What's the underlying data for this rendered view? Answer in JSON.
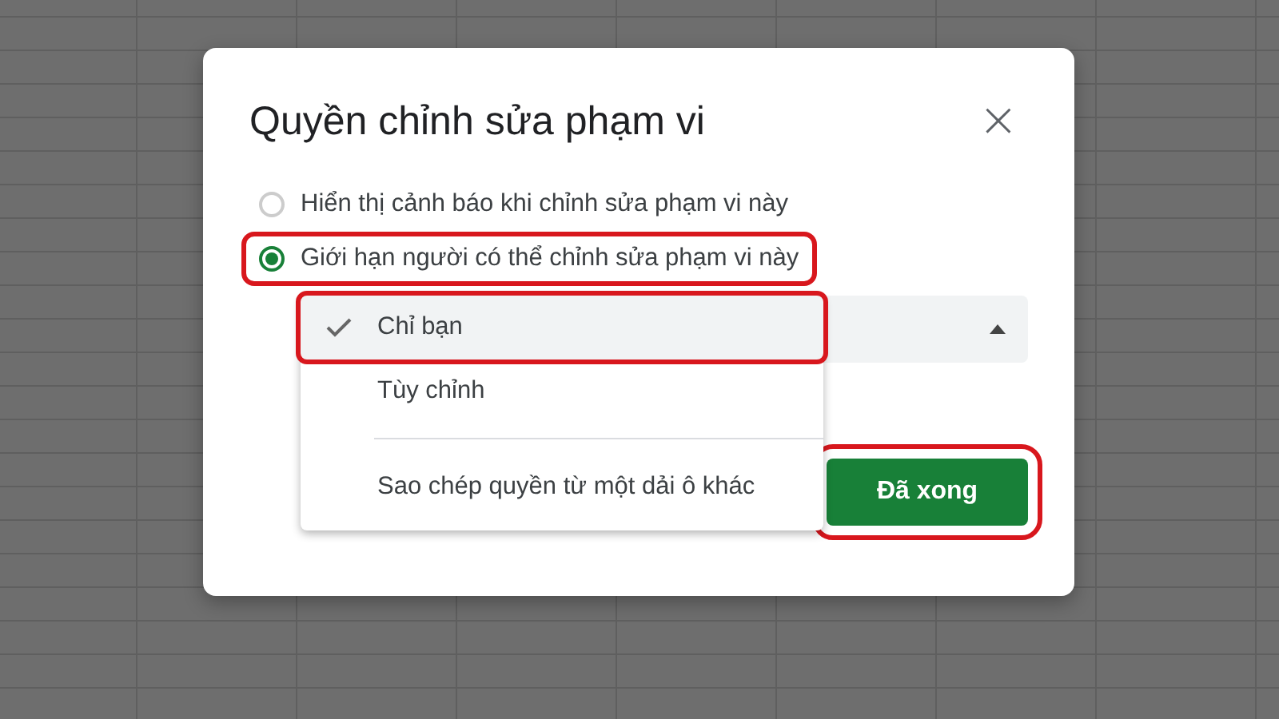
{
  "dialog": {
    "title": "Quyền chỉnh sửa phạm vi",
    "close": "×"
  },
  "options": [
    {
      "label": "Hiển thị cảnh báo khi chỉnh sửa phạm vi này",
      "selected": false,
      "highlighted": false
    },
    {
      "label": "Giới hạn người có thể chỉnh sửa phạm vi này",
      "selected": true,
      "highlighted": true
    }
  ],
  "dropdown": {
    "expanded": true,
    "menu": [
      {
        "kind": "option",
        "label": "Chỉ bạn",
        "selected": true,
        "highlighted": true
      },
      {
        "kind": "option",
        "label": "Tùy chỉnh",
        "selected": false,
        "highlighted": false
      },
      {
        "kind": "divider"
      },
      {
        "kind": "option",
        "label": "Sao chép quyền từ một dải ô khác",
        "selected": false,
        "highlighted": false
      }
    ]
  },
  "done_button": {
    "label": "Đã xong",
    "highlighted": true
  }
}
